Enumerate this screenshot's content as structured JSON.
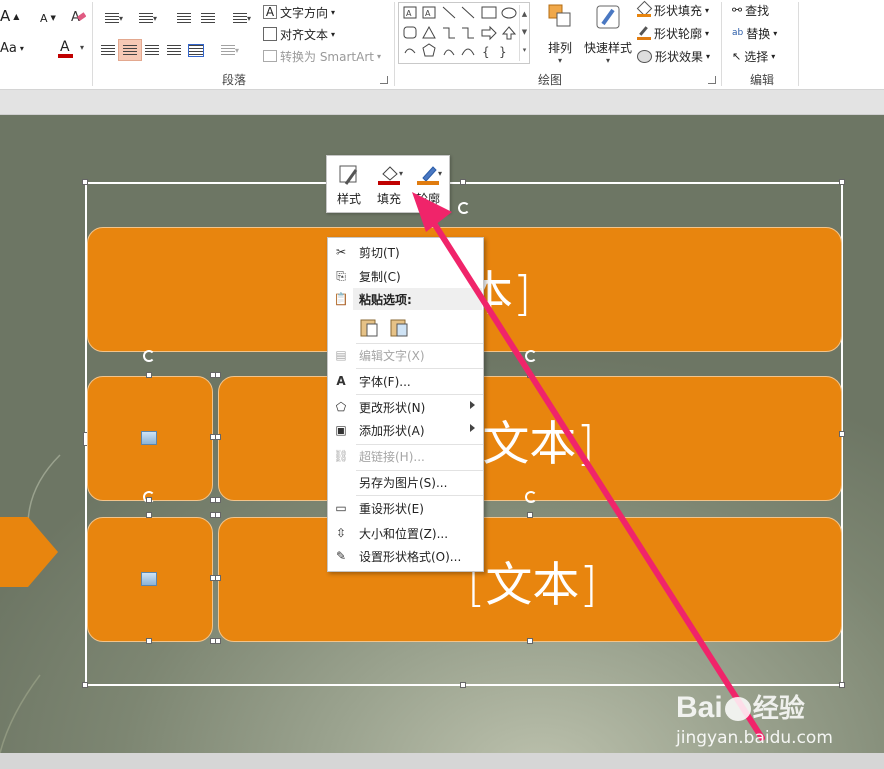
{
  "ribbon": {
    "font": {
      "grow_label": "A",
      "shrink_label": "A",
      "case_label": "Aa",
      "font_color_label": "A"
    },
    "paragraph": {
      "group_label": "段落",
      "text_direction_label": "文字方向",
      "align_text_label": "对齐文本",
      "convert_smartart_label": "转换为 SmartArt"
    },
    "drawing": {
      "group_label": "绘图",
      "arrange_label": "排列",
      "quick_styles_label": "快速样式",
      "shape_fill_label": "形状填充",
      "shape_outline_label": "形状轮廓",
      "shape_effects_label": "形状效果"
    },
    "editing": {
      "group_label": "编辑",
      "find_label": "查找",
      "replace_label": "替换",
      "select_label": "选择"
    }
  },
  "slide": {
    "top_box_text": "本]",
    "middle_box_text": "[文本]",
    "bottom_box_text": "[文本]",
    "accent_color": "#e8850e"
  },
  "mini_toolbar": {
    "style_label": "样式",
    "fill_label": "填充",
    "outline_label": "轮廓"
  },
  "context_menu": {
    "cut": "剪切(T)",
    "copy": "复制(C)",
    "paste_options": "粘贴选项:",
    "edit_text": "编辑文字(X)",
    "font": "字体(F)...",
    "change_shape": "更改形状(N)",
    "add_shape": "添加形状(A)",
    "hyperlink": "超链接(H)...",
    "save_as_picture": "另存为图片(S)...",
    "reset_shape": "重设形状(E)",
    "size_position": "大小和位置(Z)...",
    "format_shape": "设置形状格式(O)..."
  },
  "watermark": {
    "brand_text": "Bai",
    "brand_suffix": "经验",
    "url": "jingyan.baidu.com"
  },
  "colors": {
    "arrow": "#f0246a",
    "orange": "#e8850e",
    "font_red": "#c00000",
    "outline_orange": "#e07c10"
  }
}
